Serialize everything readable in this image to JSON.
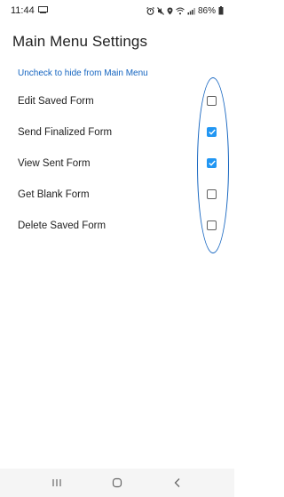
{
  "status_bar": {
    "time": "11:44",
    "battery": "86%"
  },
  "app_bar": {
    "title": "Main Menu Settings"
  },
  "section": {
    "header": "Uncheck to hide from Main Menu"
  },
  "settings": [
    {
      "label": "Edit Saved Form",
      "checked": false
    },
    {
      "label": "Send Finalized Form",
      "checked": true
    },
    {
      "label": "View Sent Form",
      "checked": true
    },
    {
      "label": "Get Blank Form",
      "checked": false
    },
    {
      "label": "Delete Saved Form",
      "checked": false
    }
  ],
  "colors": {
    "accent": "#2196f3",
    "section_header": "#1565c0",
    "annotation": "#1565c0"
  },
  "nav_bar": {
    "icons": [
      "recents-icon",
      "home-icon",
      "back-icon"
    ]
  }
}
